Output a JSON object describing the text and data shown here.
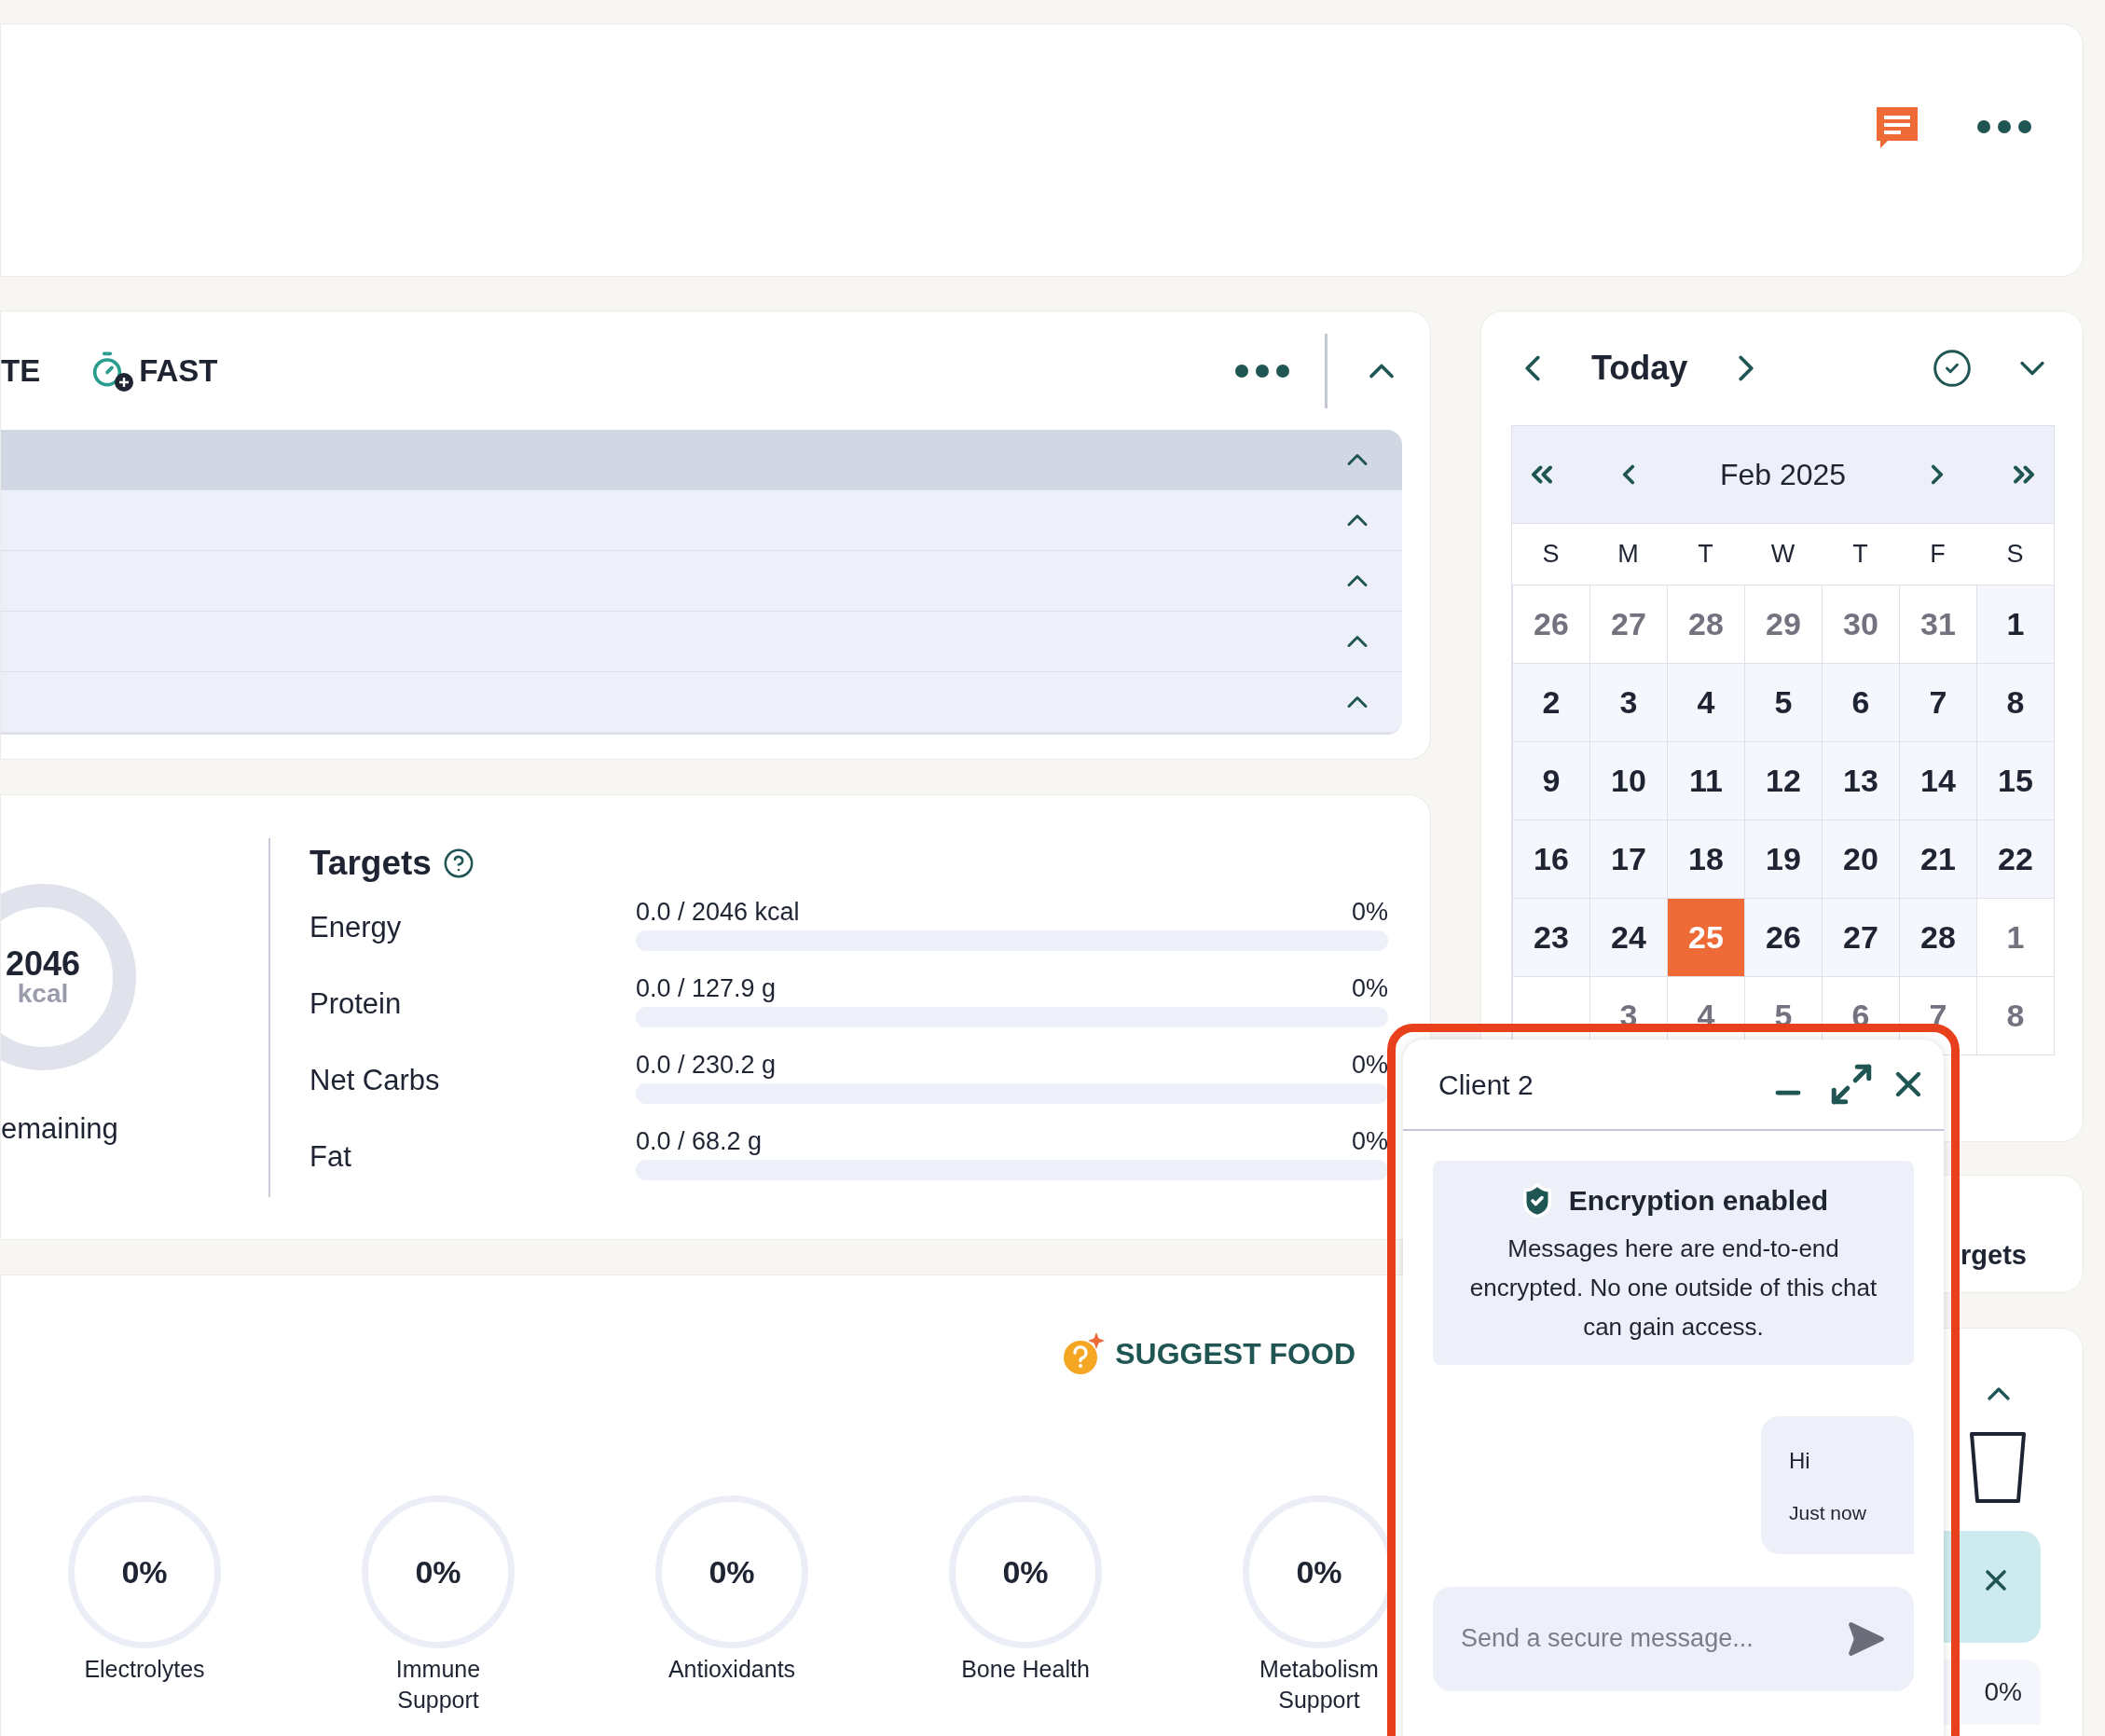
{
  "meal_toolbar": {
    "actions": [
      {
        "label": "TE",
        "kind": "text"
      },
      {
        "label": "FAST",
        "kind": "timer"
      }
    ]
  },
  "meal_rows": [
    {
      "selected": true,
      "expanded": true
    },
    {
      "selected": false,
      "expanded": true
    },
    {
      "selected": false,
      "expanded": true
    },
    {
      "selected": false,
      "expanded": true
    },
    {
      "selected": false,
      "expanded": true
    }
  ],
  "energy_summary": {
    "value": "2046",
    "unit": "kcal",
    "caption": "emaining"
  },
  "targets": {
    "title": "Targets",
    "rows": [
      {
        "label": "Energy",
        "reading": "0.0 / 2046 kcal",
        "percent": "0%",
        "level": 0
      },
      {
        "label": "Protein",
        "reading": "0.0 / 127.9 g",
        "percent": "0%",
        "level": 0
      },
      {
        "label": "Net Carbs",
        "reading": "0.0 / 230.2 g",
        "percent": "0%",
        "level": 0
      },
      {
        "label": "Fat",
        "reading": "0.0 / 68.2 g",
        "percent": "0%",
        "level": 0
      }
    ]
  },
  "suggest": {
    "label": "SUGGEST FOOD"
  },
  "nutrient_scores": [
    {
      "value": "0%",
      "label": "Electrolytes"
    },
    {
      "value": "0%",
      "label": "Immune Support"
    },
    {
      "value": "0%",
      "label": "Antioxidants"
    },
    {
      "value": "0%",
      "label": "Bone Health"
    },
    {
      "value": "0%",
      "label": "Metabolism Support"
    }
  ],
  "day_nav": {
    "label": "Today",
    "done": true
  },
  "calendar": {
    "month": "Feb 2025",
    "weekdays": [
      "S",
      "M",
      "T",
      "W",
      "T",
      "F",
      "S"
    ],
    "weeks": [
      [
        {
          "day": "26",
          "muted": true,
          "selected": false
        },
        {
          "day": "27",
          "muted": true,
          "selected": false
        },
        {
          "day": "28",
          "muted": true,
          "selected": false
        },
        {
          "day": "29",
          "muted": true,
          "selected": false
        },
        {
          "day": "30",
          "muted": true,
          "selected": false
        },
        {
          "day": "31",
          "muted": true,
          "selected": false
        },
        {
          "day": "1",
          "muted": false,
          "selected": false
        }
      ],
      [
        {
          "day": "2",
          "muted": false,
          "selected": false
        },
        {
          "day": "3",
          "muted": false,
          "selected": false
        },
        {
          "day": "4",
          "muted": false,
          "selected": false
        },
        {
          "day": "5",
          "muted": false,
          "selected": false
        },
        {
          "day": "6",
          "muted": false,
          "selected": false
        },
        {
          "day": "7",
          "muted": false,
          "selected": false
        },
        {
          "day": "8",
          "muted": false,
          "selected": false
        }
      ],
      [
        {
          "day": "9",
          "muted": false,
          "selected": false
        },
        {
          "day": "10",
          "muted": false,
          "selected": false
        },
        {
          "day": "11",
          "muted": false,
          "selected": false
        },
        {
          "day": "12",
          "muted": false,
          "selected": false
        },
        {
          "day": "13",
          "muted": false,
          "selected": false
        },
        {
          "day": "14",
          "muted": false,
          "selected": false
        },
        {
          "day": "15",
          "muted": false,
          "selected": false
        }
      ],
      [
        {
          "day": "16",
          "muted": false,
          "selected": false
        },
        {
          "day": "17",
          "muted": false,
          "selected": false
        },
        {
          "day": "18",
          "muted": false,
          "selected": false
        },
        {
          "day": "19",
          "muted": false,
          "selected": false
        },
        {
          "day": "20",
          "muted": false,
          "selected": false
        },
        {
          "day": "21",
          "muted": false,
          "selected": false
        },
        {
          "day": "22",
          "muted": false,
          "selected": false
        }
      ],
      [
        {
          "day": "23",
          "muted": false,
          "selected": false
        },
        {
          "day": "24",
          "muted": false,
          "selected": false
        },
        {
          "day": "25",
          "muted": false,
          "selected": true
        },
        {
          "day": "26",
          "muted": false,
          "selected": false
        },
        {
          "day": "27",
          "muted": false,
          "selected": false
        },
        {
          "day": "28",
          "muted": false,
          "selected": false
        },
        {
          "day": "1",
          "muted": true,
          "selected": false
        }
      ],
      [
        {
          "selected": false
        },
        {
          "day": "3",
          "muted": true,
          "selected": false
        },
        {
          "day": "4",
          "muted": true,
          "selected": false
        },
        {
          "day": "5",
          "muted": true,
          "selected": false
        },
        {
          "day": "6",
          "muted": true,
          "selected": false
        },
        {
          "day": "7",
          "muted": true,
          "selected": false
        },
        {
          "day": "8",
          "muted": true,
          "selected": false
        }
      ]
    ]
  },
  "side_card": {
    "label": "rgets"
  },
  "water_card": {
    "percent": "0%"
  },
  "chat": {
    "title": "Client 2",
    "notice": {
      "title": "Encryption enabled",
      "text": "Messages here are end-to-end encrypted. No one outside of this chat can gain access."
    },
    "messages": [
      {
        "text": "Hi",
        "time": "Just now"
      }
    ],
    "input": {
      "placeholder": "Send a secure message..."
    }
  }
}
